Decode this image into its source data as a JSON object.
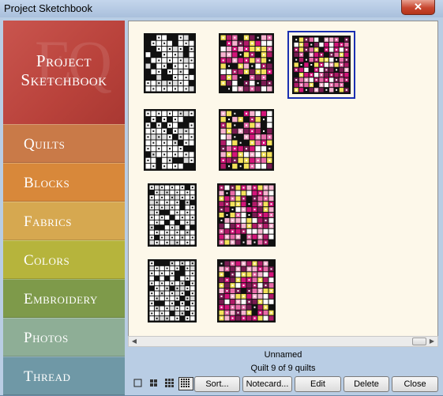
{
  "window": {
    "title": "Project Sketchbook",
    "close_glyph": "✕"
  },
  "sidebar": {
    "logo_line1": "Project",
    "logo_line2": "Sketchbook",
    "logo_monogram": "EQ",
    "items": [
      {
        "label": "Quilts",
        "color": "#c97a48"
      },
      {
        "label": "Blocks",
        "color": "#d8883a"
      },
      {
        "label": "Fabrics",
        "color": "#d6a850"
      },
      {
        "label": "Colors",
        "color": "#b6b43c"
      },
      {
        "label": "Embroidery",
        "color": "#7e9a4a"
      },
      {
        "label": "Photos",
        "color": "#8eae96"
      },
      {
        "label": "Thread",
        "color": "#6f98a6"
      }
    ]
  },
  "thumbnails": [
    {
      "style": "bw"
    },
    {
      "style": "color"
    },
    {
      "style": "color",
      "selected": true
    },
    {
      "style": "bw"
    },
    {
      "style": "color"
    },
    {
      "style": "bw"
    },
    {
      "style": "color"
    },
    {
      "style": "bw"
    },
    {
      "style": "color"
    }
  ],
  "status": {
    "name": "Unnamed",
    "count": "Quilt 9 of 9 quilts"
  },
  "toolbar": {
    "view_icons": [
      "single-view-icon",
      "four-grid-view-icon",
      "nine-grid-view-icon",
      "sixteen-grid-view-icon"
    ],
    "sort_label": "Sort...",
    "notecard_label": "Notecard...",
    "edit_label": "Edit",
    "delete_label": "Delete",
    "close_label": "Close"
  },
  "colors": {
    "selection": "#1a2fb0",
    "quilt_pink": "#d4147a",
    "quilt_yellow": "#f4e25a"
  }
}
